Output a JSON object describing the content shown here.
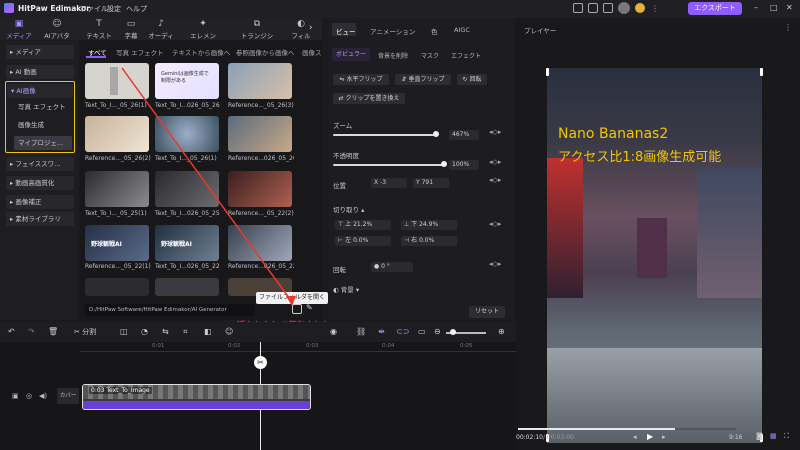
{
  "app": {
    "title": "HitPaw Edimakor",
    "menu": [
      "ファイル",
      "設定",
      "ヘルプ"
    ],
    "export_label": "エクスポート"
  },
  "toolbar": [
    {
      "label": "メディア",
      "icon": "media-icon"
    },
    {
      "label": "AIアバター",
      "icon": "avatar-icon"
    },
    {
      "label": "テキスト",
      "icon": "text-icon"
    },
    {
      "label": "字幕",
      "icon": "subtitle-icon"
    },
    {
      "label": "オーディオ",
      "icon": "audio-icon"
    },
    {
      "label": "エレメント",
      "icon": "element-icon"
    },
    {
      "label": "トランジション",
      "icon": "transition-icon"
    },
    {
      "label": "フィル",
      "icon": "filter-icon"
    }
  ],
  "sidebar": {
    "media": "メディア",
    "ai_video": "AI 動画",
    "ai_image": "AI画像",
    "ai_sub": [
      "写真 エフェクト",
      "画像生成",
      "マイプロジェ..."
    ],
    "bottom": [
      "フェイススワ...",
      "動画高画質化",
      "画像補正",
      "素材ライブラリ"
    ]
  },
  "media_tabs": [
    "すべて",
    "写真 エフェクト",
    "テキストから画像へ",
    "参照画像から画像へ",
    "画像ス"
  ],
  "thumbs": [
    "Text_To_I..._05_26(1)",
    "Text_To_I...026_05_26",
    "Reference..._05_26(3)",
    "Reference..._05_26(2)",
    "Text_To_I..._05_26(1)",
    "Reference...026_05_26",
    "Text_To_I..._05_25(1)",
    "Text_To_I...026_05_25",
    "Reference..._05_22(2)",
    "Reference..._05_22(1)",
    "Text_To_I...026_05_22",
    "Reference...026_05_22"
  ],
  "thumb_text_1": "Geminiは画像生成で制限がある",
  "thumb_text_9": "野球観戦AI",
  "thumb_text_10": "野球観戦AI",
  "path": "D:/HitPaw Software/HitPaw Edimakor/AI Generator",
  "tooltip": "ファイルフォルダを開く",
  "annotation": "透かしなしで保存された",
  "props": {
    "tabs": [
      "ビュー",
      "アニメーション",
      "色",
      "AIGC"
    ],
    "subtabs": [
      "ボピュラー",
      "背景を削除",
      "マスク",
      "エフェクト"
    ],
    "h_flip": "水平フリップ",
    "v_flip": "垂直フリップ",
    "rotate": "回転",
    "fit_clip": "クリップを置き換え",
    "zoom_label": "ズーム",
    "zoom_value": "467%",
    "opacity_label": "不透明度",
    "opacity_value": "100%",
    "position_label": "位置",
    "x_label": "X",
    "x_value": "-3",
    "y_label": "Y",
    "y_value": "791",
    "crop_label": "切り取り",
    "crop": [
      {
        "label": "上",
        "value": "21.2%"
      },
      {
        "label": "下",
        "value": "24.9%"
      },
      {
        "label": "左",
        "value": "0.0%"
      },
      {
        "label": "右",
        "value": "0.0%"
      }
    ],
    "rotate_label": "回転",
    "rotate_value": "0",
    "bg_label": "背景",
    "reset": "リセット"
  },
  "player": {
    "title": "プレイヤー",
    "overlay1": "Nano Bananas2",
    "overlay2": "アクセス比1:8画像生成可能",
    "time_current": "00:02:10",
    "time_total": "/ 00:03:00",
    "ratio": "9:16",
    "progress": 0.72
  },
  "timeline": {
    "split": "分割",
    "ticks": [
      "0:01",
      "0:02",
      "0:03",
      "0:04",
      "0:05",
      "0:06"
    ],
    "clip_label": "0:03 Text_To_Image",
    "cover_label": "カバー"
  },
  "colors": {
    "accent": "#8f5cff",
    "highlight": "#f0c419",
    "annotation": "#e6392f",
    "overlay_text": "#f5c400"
  }
}
